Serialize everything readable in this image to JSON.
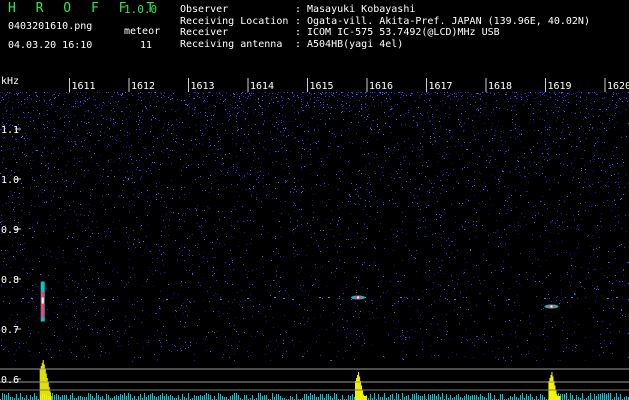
{
  "header": {
    "app_title": "H R O F F T",
    "app_version": "1.0.0",
    "filename": "0403201610.png",
    "datetime": "04.03.20 16:10",
    "meteor_label": "meteor",
    "meteor_count": "11",
    "info": [
      {
        "label": "Observer",
        "sep": ":",
        "value": "Masayuki Kobayashi"
      },
      {
        "label": "Receiving Location",
        "sep": ":",
        "value": "Ogata-vill. Akita-Pref. JAPAN (139.96E, 40.02N)"
      },
      {
        "label": "Receiver",
        "sep": ":",
        "value": "ICOM IC-575 53.7492(@LCD)MHz USB"
      },
      {
        "label": "Receiving antenna",
        "sep": ":",
        "value": "A504HB(yagi 4el)"
      }
    ]
  },
  "spectrogram": {
    "freq_unit": "kHz",
    "x_ticks": [
      "1611",
      "1612",
      "1613",
      "1614",
      "1615",
      "1616",
      "1617",
      "1618",
      "1619",
      "1620"
    ],
    "y_ticks": [
      "1.1",
      "1.0",
      "0.9",
      "0.8",
      "0.7",
      "0.6"
    ],
    "background_color": "#000000",
    "noise_color": "#2a2ad8",
    "echo_color": "#ff3b7a",
    "level_color": "#ffff00",
    "meteor_echoes": [
      {
        "time_min": 1610.55,
        "freq_khz": 0.755,
        "strength": "strong"
      },
      {
        "time_min": 1615.85,
        "freq_khz": 0.763,
        "strength": "medium"
      },
      {
        "time_min": 1619.1,
        "freq_khz": 0.745,
        "strength": "medium"
      }
    ]
  }
}
